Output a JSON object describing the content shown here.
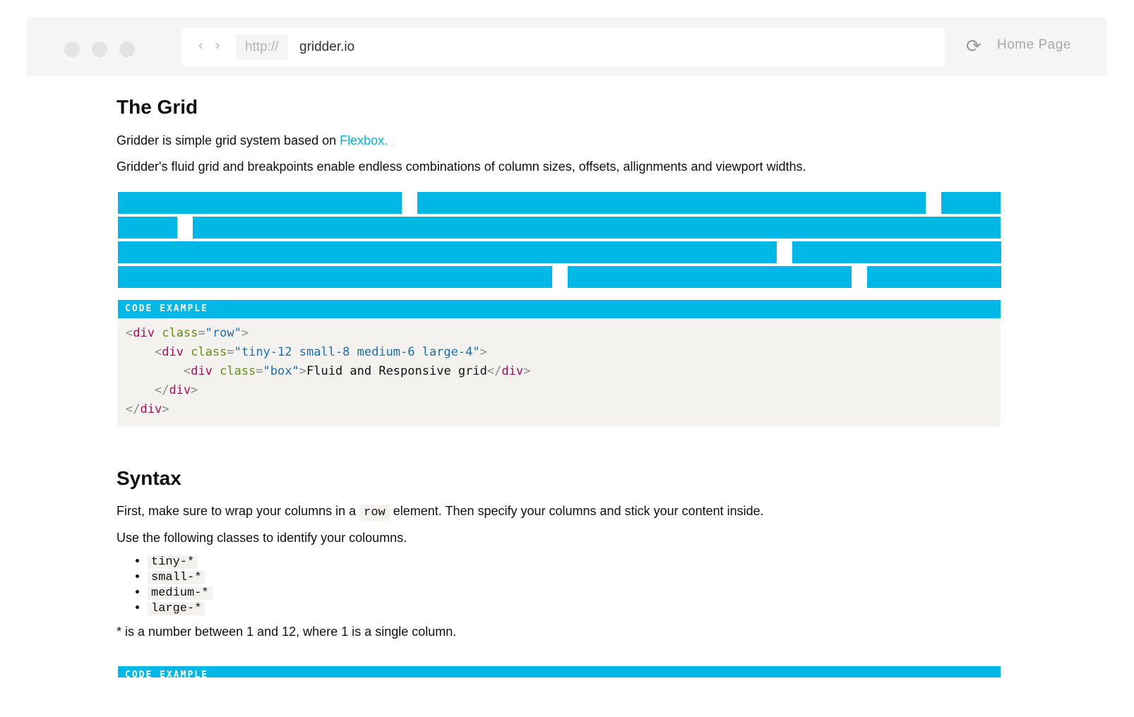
{
  "browser": {
    "protocol": "http://",
    "url": "gridder.io",
    "home_label": "Home Page",
    "icons": {
      "back": "chevron-left-icon",
      "forward": "chevron-right-icon",
      "reload": "reload-icon"
    }
  },
  "grid_section": {
    "title": "The Grid",
    "intro_prefix": "Gridder is simple grid system based on ",
    "intro_link": "Flexbox.",
    "description": "Gridder's fluid grid and breakpoints enable endless combinations of column sizes, offsets, allignments and viewport widths."
  },
  "code_example_1": {
    "header": "Code Example",
    "lines": [
      {
        "indent": "",
        "open": "<",
        "tag": "div",
        "attr": "class",
        "eq": "=",
        "value": "\"row\"",
        "close": ">",
        "text": "",
        "end": ""
      },
      {
        "indent": "    ",
        "open": "<",
        "tag": "div",
        "attr": "class",
        "eq": "=",
        "value": "\"tiny-12 small-8 medium-6 large-4\"",
        "close": ">",
        "text": "",
        "end": ""
      },
      {
        "indent": "        ",
        "open": "<",
        "tag": "div",
        "attr": "class",
        "eq": "=",
        "value": "\"box\"",
        "close": ">",
        "text": "Fluid and Responsive grid",
        "end": "</div>"
      },
      {
        "indent": "    ",
        "open": "</",
        "tag": "div",
        "attr": "",
        "eq": "",
        "value": "",
        "close": ">",
        "text": "",
        "end": ""
      },
      {
        "indent": "",
        "open": "</",
        "tag": "div",
        "attr": "",
        "eq": "",
        "value": "",
        "close": ">",
        "text": "",
        "end": ""
      }
    ]
  },
  "syntax_section": {
    "title": "Syntax",
    "line1_prefix": "First, make sure to wrap your columns in a ",
    "line1_code": "row",
    "line1_suffix": " element. Then specify your columns and stick your content inside.",
    "line2": "Use the following classes to identify your coloumns.",
    "classes": [
      "tiny-*",
      "small-*",
      "medium-*",
      "large-*"
    ],
    "note": "* is a number between 1 and 12, where 1 is a single column."
  },
  "code_example_2": {
    "header": "Code Example"
  },
  "colors": {
    "accent": "#00b8e6",
    "link": "#00b1e6",
    "code_bg": "#f4f2ef"
  }
}
